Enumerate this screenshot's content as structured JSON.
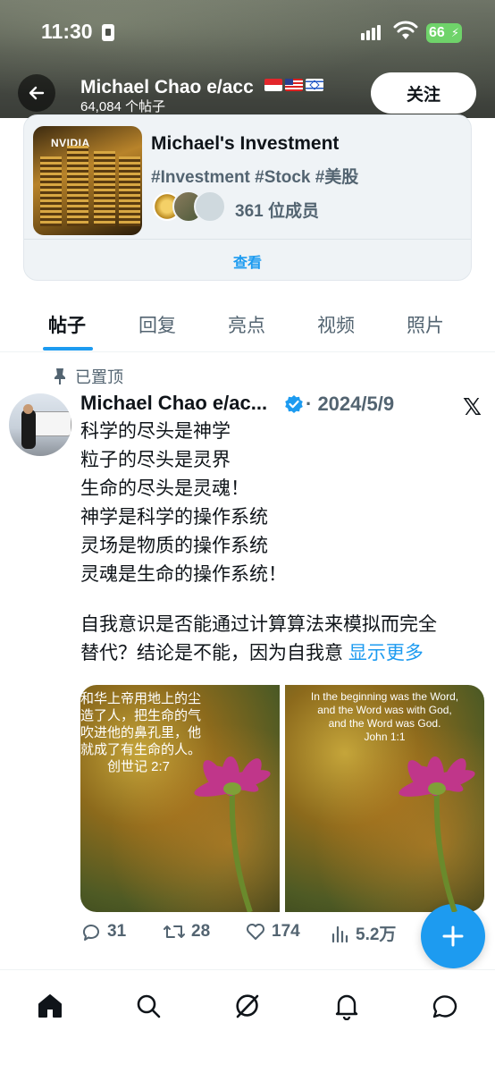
{
  "status_bar": {
    "time": "11:30",
    "battery": "66"
  },
  "header": {
    "name": "Michael Chao e/acc",
    "post_count": "64,084 个帖子",
    "follow_label": "关注"
  },
  "community": {
    "name": "Michael's Investment",
    "tags": "#Investment #Stock #美股",
    "members": "361 位成员",
    "view_label": "查看",
    "thumb_label": "NVIDIA"
  },
  "tabs": [
    {
      "label": "帖子",
      "active": true
    },
    {
      "label": "回复",
      "active": false
    },
    {
      "label": "亮点",
      "active": false
    },
    {
      "label": "视频",
      "active": false
    },
    {
      "label": "照片",
      "active": false
    }
  ],
  "post": {
    "pinned_label": "已置顶",
    "author": "Michael Chao e/ac...",
    "date": "· 2024/5/9",
    "lines": [
      "科学的尽头是神学",
      "粒子的尽头是灵界",
      "生命的尽头是灵魂！",
      "神学是科学的操作系统",
      "灵场是物质的操作系统",
      "灵魂是生命的操作系统！"
    ],
    "para2_line1": "自我意识是否能通过计算算法来模拟而完全",
    "para2_line2": "替代？结论是不能，因为自我意 ",
    "show_more": "显示更多",
    "image1_caption": [
      "和华上帝用地上的尘",
      "造了人，把生命的气",
      "吹进他的鼻孔里，他",
      "就成了有生命的人。"
    ],
    "image1_ref": "创世记 2:7",
    "image2_caption": [
      "In the beginning was the Word,",
      "and the Word was with God,",
      "and the Word was God.",
      "John 1:1"
    ],
    "replies": "31",
    "reposts": "28",
    "likes": "174",
    "views": "5.2万"
  },
  "colors": {
    "accent": "#1d9bf0",
    "text_primary": "#0f1419",
    "text_secondary": "#536471"
  },
  "icons": {
    "back": "arrow-left-icon",
    "verified": "verified-badge-icon",
    "x": "x-logo-icon",
    "compose": "plus-icon",
    "nav": [
      "home-icon",
      "search-icon",
      "grok-icon",
      "bell-icon",
      "message-icon"
    ]
  }
}
